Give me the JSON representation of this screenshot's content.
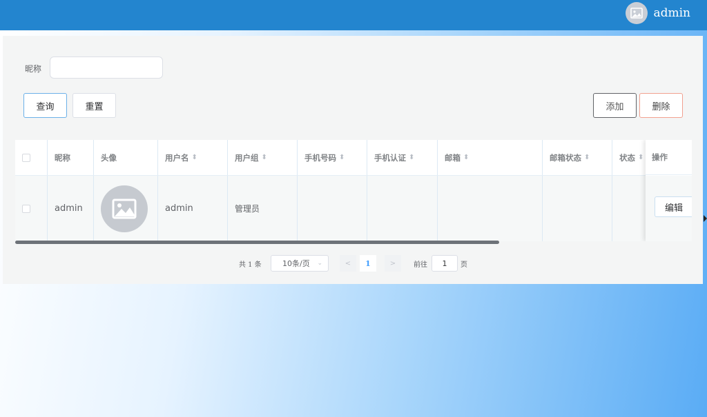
{
  "header": {
    "username": "admin"
  },
  "search": {
    "label": "昵称",
    "value": ""
  },
  "toolbar": {
    "query": "查询",
    "reset": "重置",
    "add": "添加",
    "delete": "删除"
  },
  "table": {
    "columns": [
      "昵称",
      "头像",
      "用户名",
      "用户组",
      "手机号码",
      "手机认证",
      "邮箱",
      "邮箱状态",
      "状态",
      "操作"
    ],
    "rows": [
      {
        "nickname": "admin",
        "avatar": "image-placeholder",
        "username": "admin",
        "group": "管理员",
        "phone": "",
        "phone_verified": "",
        "email": "",
        "email_status": "",
        "status": "",
        "action": "编辑"
      }
    ]
  },
  "pagination": {
    "total": "共 1 条",
    "page_size": "10条/页",
    "prev": "<",
    "current": "1",
    "next": ">",
    "goto_label": "前往",
    "goto_value": "1",
    "page_suffix": "页"
  },
  "colors": {
    "header": "#2385cf",
    "accent": "#409eff"
  }
}
